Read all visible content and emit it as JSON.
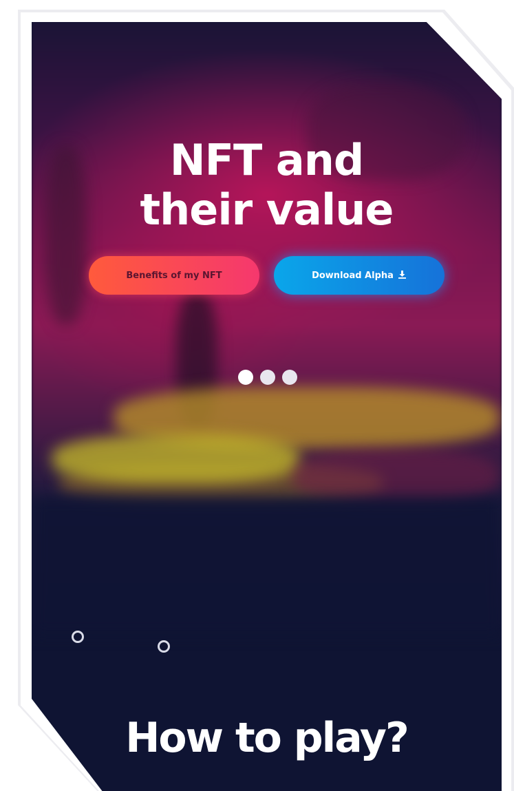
{
  "hero": {
    "title_line1": "NFT and",
    "title_line2": "their value"
  },
  "buttons": {
    "benefits_label": "Benefits of my NFT",
    "download_label": "Download Alpha",
    "download_icon": "download-icon"
  },
  "carousel": {
    "slide_count": 3,
    "active_index": 0
  },
  "section": {
    "title": "How to play?"
  },
  "colors": {
    "background": "#0f1433",
    "benefits_gradient_start": "#ff5a3c",
    "benefits_gradient_end": "#f5386e",
    "download_gradient_start": "#0aa6ea",
    "download_gradient_end": "#1672d9"
  }
}
